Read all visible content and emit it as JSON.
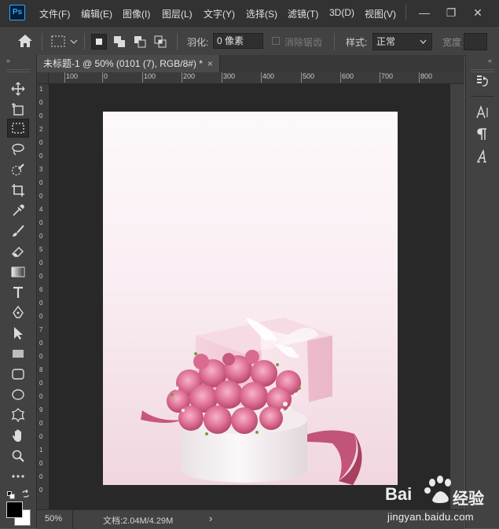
{
  "app": {
    "logo_text": "Ps"
  },
  "menu": {
    "items": [
      {
        "label": "文件(F)"
      },
      {
        "label": "编辑(E)"
      },
      {
        "label": "图像(I)"
      },
      {
        "label": "图层(L)"
      },
      {
        "label": "文字(Y)"
      },
      {
        "label": "选择(S)"
      },
      {
        "label": "滤镜(T)"
      },
      {
        "label": "3D(D)"
      },
      {
        "label": "视图(V)"
      }
    ]
  },
  "window_controls": {
    "minimize": "—",
    "restore": "❐",
    "close": "✕"
  },
  "options": {
    "feather_label": "羽化:",
    "feather_value": "0 像素",
    "antialias_label": "消除锯齿",
    "style_label": "样式:",
    "style_value": "正常",
    "width_label": "宽度"
  },
  "document": {
    "tab_title": "未标题-1 @ 50% (0101 (7), RGB/8#) *",
    "close": "×"
  },
  "ruler": {
    "h_ticks": [
      "100",
      "0",
      "100",
      "200",
      "300",
      "400",
      "500",
      "600",
      "700",
      "800"
    ],
    "v_ticks": [
      "1",
      "0",
      "0",
      "2",
      "0",
      "0",
      "3",
      "0",
      "0",
      "4",
      "0",
      "0",
      "5",
      "0",
      "0",
      "6",
      "0",
      "0",
      "7",
      "0",
      "0",
      "8",
      "0",
      "0",
      "9",
      "0",
      "0",
      "1",
      "0",
      "0",
      "0"
    ]
  },
  "status": {
    "zoom": "50%",
    "doc_info": "文档:2.04M/4.29M",
    "arrow": "›"
  },
  "panel": {
    "collapse_left": "«",
    "collapse_right": "»",
    "icons": [
      "history-icon",
      "character-icon",
      "paragraph-icon",
      "glyphs-icon"
    ]
  },
  "watermark": {
    "brand": "Bai",
    "brand_suffix": "经验",
    "url": "jingyan.baidu.com"
  },
  "colors": {
    "accent": "#31a8ff",
    "foreground": "#000000",
    "background": "#ffffff",
    "rose": "#d9537e",
    "box_pink": "#f2c7d4"
  }
}
